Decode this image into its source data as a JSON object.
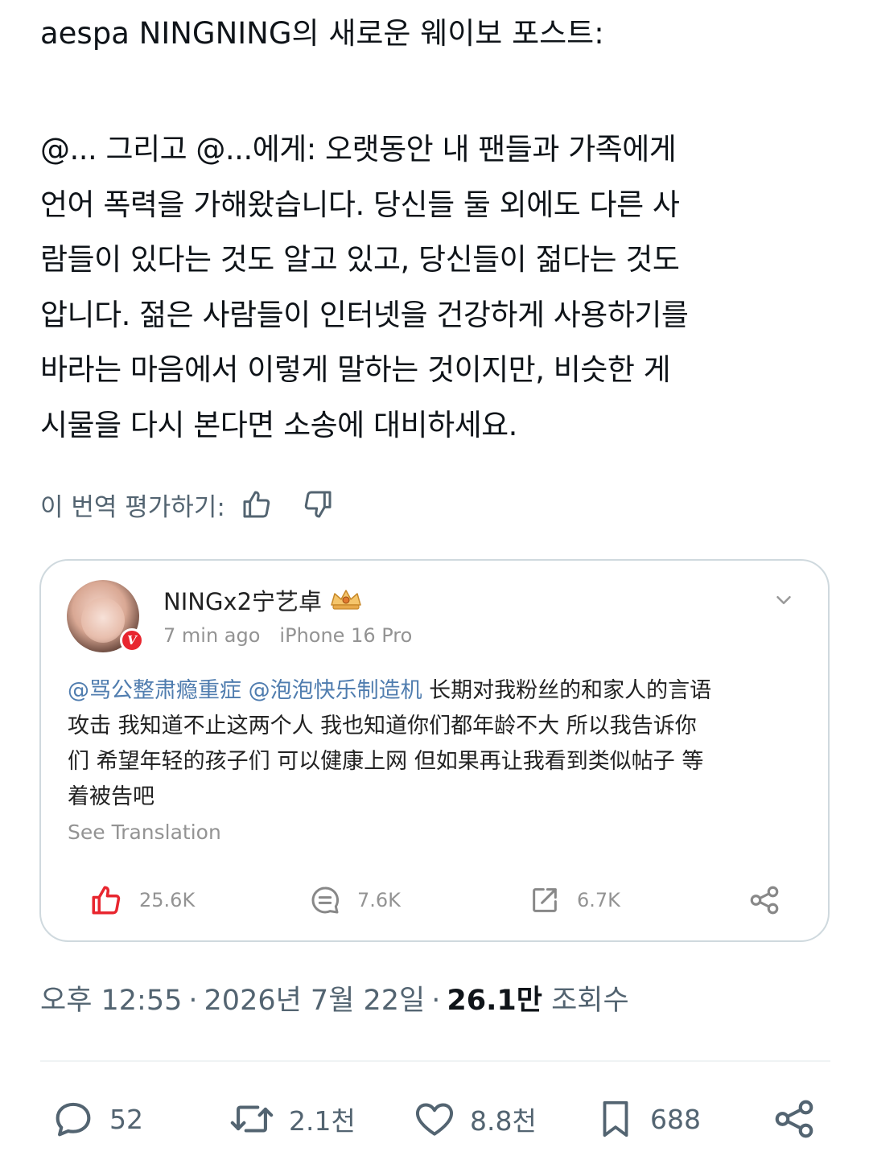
{
  "post": {
    "intro": "aespa NINGNING의 새로운 웨이보 포스트:",
    "body_lines": [
      "@... 그리고 @...에게: 오랫동안 내 팬들과 가족에게",
      "언어 폭력을 가해왔습니다. 당신들 둘 외에도 다른 사",
      "람들이 있다는 것도 알고 있고, 당신들이 젊다는 것도",
      "압니다. 젊은 사람들이 인터넷을 건강하게 사용하기를",
      "바라는 마음에서 이렇게 말하는 것이지만, 비슷한 게",
      "시물을 다시 본다면 소송에 대비하세요."
    ],
    "rate_label": "이 번역 평가하기:",
    "rate_icons": [
      "thumbs-up-icon",
      "thumbs-down-icon"
    ]
  },
  "weibo": {
    "username": "NINGx2宁艺卓",
    "badge_icon": "crown-icon",
    "verified_label": "V",
    "time_ago": "7 min ago",
    "device": "iPhone 16 Pro",
    "mention_1": "@骂公整肃瘾重症",
    "mention_2": "@泡泡快乐制造机",
    "line1_rest": " 长期对我粉丝的和家人的言语",
    "line2": "攻击 我知道不止这两个人 我也知道你们都年龄不大 所以我告诉你",
    "line3": "们 希望年轻的孩子们 可以健康上网 但如果再让我看到类似帖子 等",
    "line4": "着被告吧",
    "see_translation": "See Translation",
    "likes": "25.6K",
    "comments": "7.6K",
    "reposts": "6.7K",
    "accent_color": "#e8262f",
    "mention_color": "#507daf"
  },
  "timestamp": {
    "time": "오후 12:55",
    "separator": "·",
    "date": "2026년 7월 22일",
    "views_count": "26.1만",
    "views_label": "조회수"
  },
  "actions": {
    "replies": "52",
    "retweets": "2.1천",
    "likes": "8.8천",
    "bookmarks": "688"
  },
  "colors": {
    "text": "#0f1419",
    "secondary": "#536471",
    "border": "#cfd9de"
  }
}
